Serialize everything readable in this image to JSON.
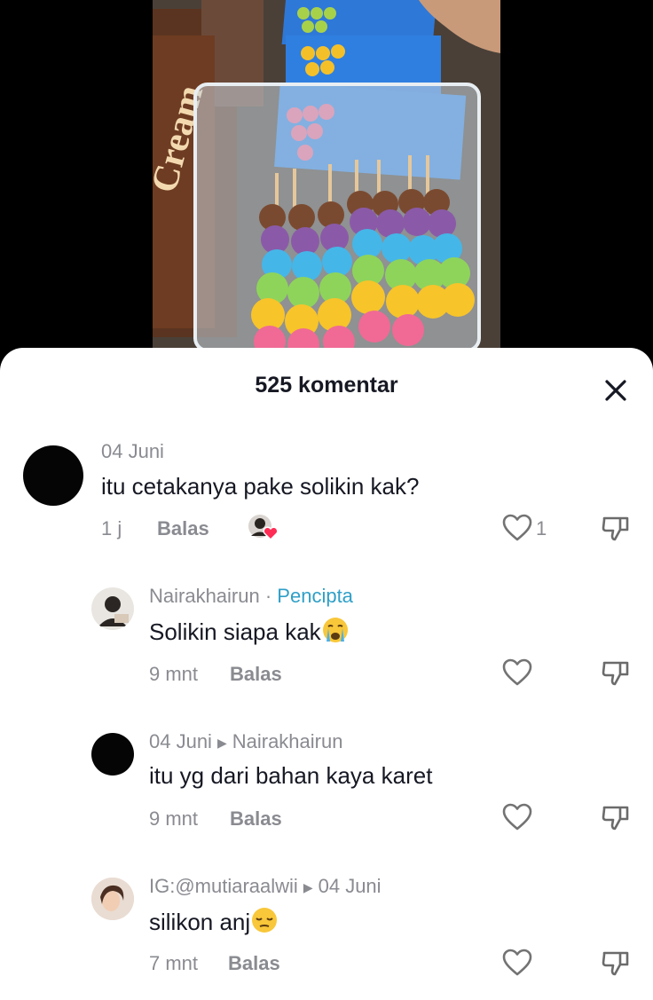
{
  "comments_header": {
    "title": "525 komentar"
  },
  "comments": [
    {
      "id": "c1",
      "date": "04 Juni",
      "text": "itu cetakanya pake solikin kak?",
      "time": "1 j",
      "reply_label": "Balas",
      "likes": "1"
    },
    {
      "id": "c2",
      "username": "Nairakhairun",
      "separator": " · ",
      "creator_badge": "Pencipta",
      "text": "Solikin siapa kak",
      "time": "9 mnt",
      "reply_label": "Balas"
    },
    {
      "id": "c3",
      "date": "04 Juni",
      "reply_to": "Nairakhairun",
      "text": "itu yg dari bahan kaya karet",
      "time": "9 mnt",
      "reply_label": "Balas"
    },
    {
      "id": "c4",
      "username": "IG:@mutiaraalwii",
      "date": "04 Juni",
      "text": "silikon anj",
      "time": "7 mnt",
      "reply_label": "Balas"
    }
  ],
  "colors": {
    "accent": "#2f9fc7",
    "text_primary": "#161823",
    "text_secondary": "#8a8b91"
  },
  "icons": [
    "close-icon",
    "heart-outline-icon",
    "dislike-icon",
    "creator-liked-icon"
  ]
}
